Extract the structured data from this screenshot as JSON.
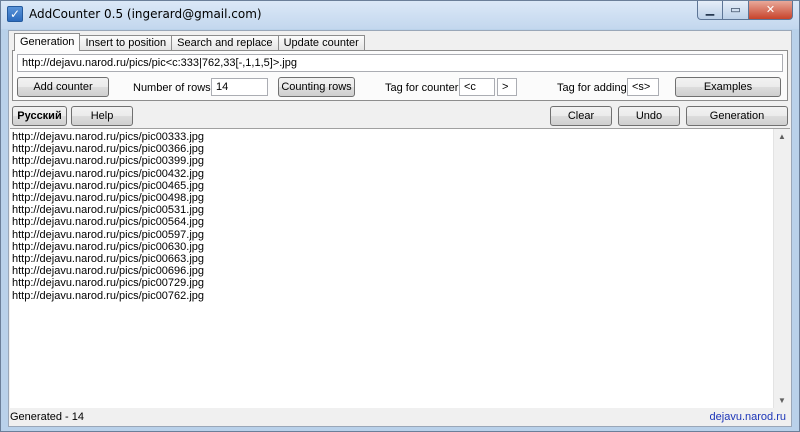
{
  "window": {
    "title": "AddCounter 0.5 (ingerard@gmail.com)"
  },
  "tabs": [
    {
      "label": "Generation",
      "active": true
    },
    {
      "label": "Insert to position",
      "active": false
    },
    {
      "label": "Search and replace",
      "active": false
    },
    {
      "label": "Update counter",
      "active": false
    }
  ],
  "generation": {
    "template_value": "http://dejavu.narod.ru/pics/pic<c:333|762,33[-,1,1,5]>.jpg",
    "add_counter_label": "Add counter",
    "rows_label": "Number of rows:",
    "rows_value": "14",
    "counting_rows_label": "Counting rows",
    "tag_counter_label": "Tag for counter:",
    "tag_counter_open": "<c",
    "tag_counter_close": ">",
    "tag_adding_label": "Tag for adding:",
    "tag_adding_value": "<s>",
    "examples_label": "Examples"
  },
  "toolbar": {
    "russian_label": "Русский",
    "help_label": "Help",
    "clear_label": "Clear",
    "undo_label": "Undo",
    "generation_label": "Generation"
  },
  "output": {
    "lines": [
      "http://dejavu.narod.ru/pics/pic00333.jpg",
      "http://dejavu.narod.ru/pics/pic00366.jpg",
      "http://dejavu.narod.ru/pics/pic00399.jpg",
      "http://dejavu.narod.ru/pics/pic00432.jpg",
      "http://dejavu.narod.ru/pics/pic00465.jpg",
      "http://dejavu.narod.ru/pics/pic00498.jpg",
      "http://dejavu.narod.ru/pics/pic00531.jpg",
      "http://dejavu.narod.ru/pics/pic00564.jpg",
      "http://dejavu.narod.ru/pics/pic00597.jpg",
      "http://dejavu.narod.ru/pics/pic00630.jpg",
      "http://dejavu.narod.ru/pics/pic00663.jpg",
      "http://dejavu.narod.ru/pics/pic00696.jpg",
      "http://dejavu.narod.ru/pics/pic00729.jpg",
      "http://dejavu.narod.ru/pics/pic00762.jpg"
    ]
  },
  "status": {
    "text": "Generated - 14",
    "link": "dejavu.narod.ru"
  }
}
